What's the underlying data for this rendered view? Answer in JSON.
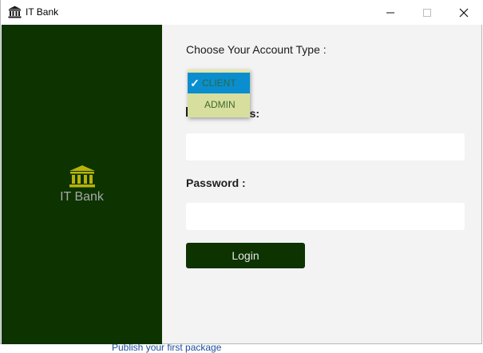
{
  "window": {
    "title": "IT Bank"
  },
  "sidebar": {
    "brand": "IT Bank"
  },
  "form": {
    "account_type_label": "Choose Your Account Type :",
    "account_type_options": [
      "CLIENT",
      "ADMIN"
    ],
    "account_type_selected": "CLIENT",
    "account_type_check": "✓",
    "email_label_visible": "ess:",
    "password_label": "Password :",
    "login_label": "Login"
  },
  "background": {
    "peek_text": "Publish your first package"
  },
  "colors": {
    "sidebar_bg": "#0c3300",
    "icon_gold": "#b9b20a",
    "dropdown_bg": "#d8df9e",
    "selected_bg": "#0a8ed0",
    "form_bg": "#f3f3f3"
  }
}
